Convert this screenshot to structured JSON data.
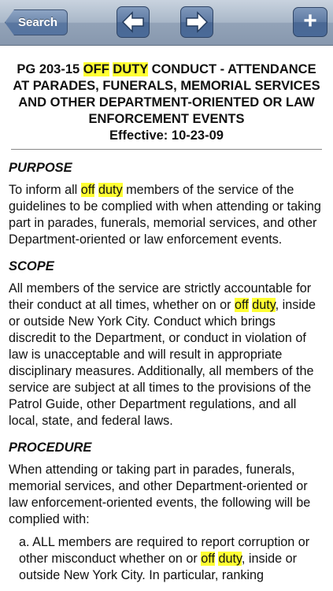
{
  "toolbar": {
    "search_label": "Search",
    "back_icon": "arrow-left-icon",
    "forward_icon": "arrow-right-icon",
    "add_icon": "plus-icon",
    "add_label": "+"
  },
  "document": {
    "heading": {
      "prefix": "PG 203-15 ",
      "hl1": "OFF",
      "space": " ",
      "hl2": "DUTY",
      "rest": " CONDUCT - ATTENDANCE AT PARADES, FUNERALS, MEMORIAL SERVICES AND OTHER DEPARTMENT-ORIENTED OR LAW ENFORCEMENT EVENTS",
      "effective": "Effective: 10-23-09"
    },
    "purpose": {
      "title": "PURPOSE",
      "p1": "To inform all ",
      "hl1": "off",
      "hl2": "duty",
      "p2": " members of the service of the guidelines to be complied with when attending or taking part in parades, funerals, memorial services, and other Department-oriented or law enforcement events."
    },
    "scope": {
      "title": "SCOPE",
      "p1": "All members of the service are strictly accountable for their conduct at all times, whether on or ",
      "hl1": "off",
      "hl2": "duty",
      "p2": ", inside or outside New York City. Conduct which brings discredit to the Department, or conduct in violation of law is unacceptable and will result in appropriate disciplinary measures. Additionally, all members of the service are subject at all times to the provisions of the Patrol Guide, other Department regulations, and all local, state, and federal laws."
    },
    "procedure": {
      "title": "PROCEDURE",
      "intro": "When attending or taking part in parades, funerals, memorial services, and other Department-oriented or law enforcement-oriented events, the following will be complied with:",
      "item_a_p1": "a. ALL members are required to report corruption or other misconduct whether on or ",
      "item_a_hl1": "off",
      "item_a_hl2": "duty",
      "item_a_p2": ", inside or outside New York City. In particular, ranking"
    },
    "highlight_color": "#ffff33"
  }
}
